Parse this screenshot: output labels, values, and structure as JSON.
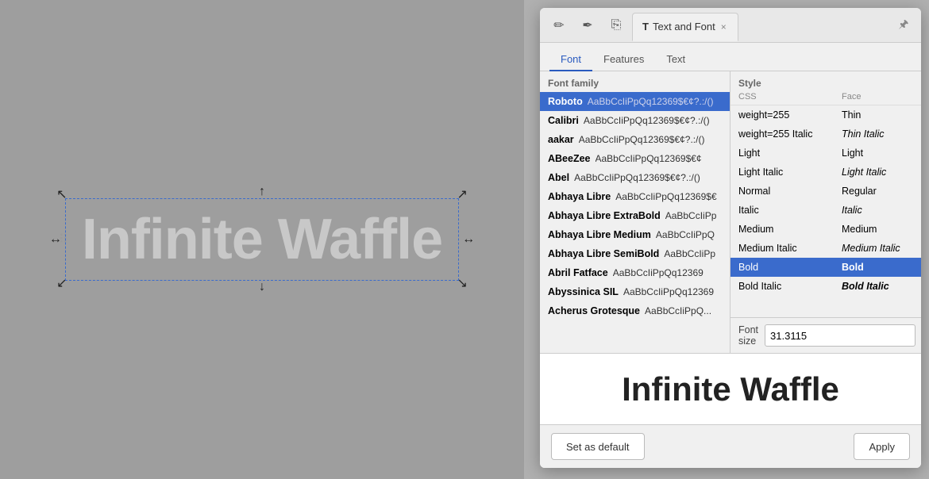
{
  "canvas": {
    "text": "Infinite Waffle"
  },
  "panel": {
    "title": "Text and Font",
    "close_label": "×",
    "pin_icon": "📌",
    "icons": [
      {
        "name": "edit-icon",
        "symbol": "✏"
      },
      {
        "name": "path-icon",
        "symbol": "✒"
      },
      {
        "name": "copy-icon",
        "symbol": "⎘"
      }
    ],
    "sub_tabs": [
      {
        "id": "font",
        "label": "Font"
      },
      {
        "id": "features",
        "label": "Features"
      },
      {
        "id": "text",
        "label": "Text"
      }
    ],
    "active_sub_tab": "font",
    "font_family_header": "Font family",
    "style_header": "Style",
    "css_col": "CSS",
    "face_col": "Face",
    "fonts": [
      {
        "name": "Roboto",
        "preview": "AaBbCcIiPpQq12369$€¢?.:/()",
        "selected": true
      },
      {
        "name": "Calibri",
        "preview": "AaBbCcIiPpQq12369$€¢?.:/()"
      },
      {
        "name": "aakar",
        "preview": "AaBbCcIiPpQq12369$€¢?.:/()"
      },
      {
        "name": "ABeeZee",
        "preview": "AaBbCcIiPpQq12369$€¢"
      },
      {
        "name": "Abel",
        "preview": "AaBbCcIiPpQq12369$€¢?.:/()"
      },
      {
        "name": "Abhaya Libre",
        "preview": "AaBbCcIiPpQq12369$€"
      },
      {
        "name": "Abhaya Libre ExtraBold",
        "preview": "AaBbCcIiPp"
      },
      {
        "name": "Abhaya Libre Medium",
        "preview": "AaBbCcIiPpQ"
      },
      {
        "name": "Abhaya Libre SemiBold",
        "preview": "AaBbCcIiPp"
      },
      {
        "name": "Abril Fatface",
        "preview": "AaBbCcIiPpQq12369"
      },
      {
        "name": "Abyssinica SIL",
        "preview": "AaBbCcIiPpQq12369"
      },
      {
        "name": "Acherus Grotesque",
        "preview": "AaBbCcIiPpQ..."
      }
    ],
    "styles": [
      {
        "css": "weight=255",
        "face": "Thin",
        "face_class": "face-thin"
      },
      {
        "css": "weight=255 Italic",
        "face": "Thin Italic",
        "face_class": "face-thin-italic"
      },
      {
        "css": "Light",
        "face": "Light",
        "face_class": "face-light"
      },
      {
        "css": "Light Italic",
        "face": "Light Italic",
        "face_class": "face-light-italic"
      },
      {
        "css": "Normal",
        "face": "Regular",
        "face_class": "face-regular"
      },
      {
        "css": "Italic",
        "face": "Italic",
        "face_class": "face-italic"
      },
      {
        "css": "Medium",
        "face": "Medium",
        "face_class": "face-medium"
      },
      {
        "css": "Medium Italic",
        "face": "Medium Italic",
        "face_class": "face-medium-italic"
      },
      {
        "css": "Bold",
        "face": "Bold",
        "face_class": "face-bold",
        "selected": true
      },
      {
        "css": "Bold Italic",
        "face": "Bold Italic",
        "face_class": "face-bold-italic"
      }
    ],
    "font_size_label": "Font size",
    "font_size_value": "31.3115",
    "preview_text": "Infinite Waffle",
    "set_as_default_label": "Set as default",
    "apply_label": "Apply"
  }
}
